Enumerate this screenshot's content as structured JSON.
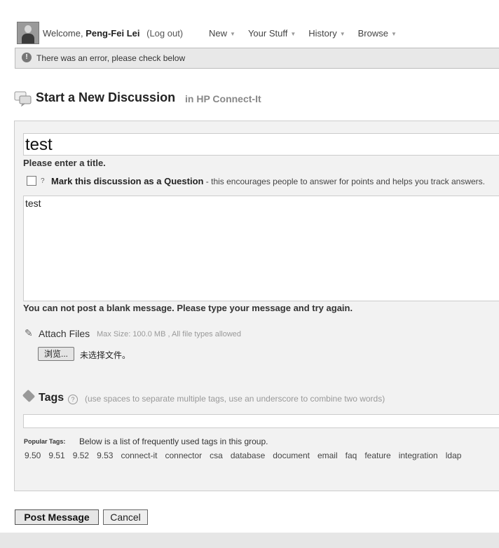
{
  "header": {
    "welcome_prefix": "Welcome,",
    "user_name": "Peng-Fei Lei",
    "logout": "(Log out)",
    "nav": [
      "New",
      "Your Stuff",
      "History",
      "Browse"
    ]
  },
  "error_bar": {
    "icon": "!",
    "message": "There was an error, please check below"
  },
  "page": {
    "title": "Start a New Discussion",
    "subtitle": "in HP Connect-It"
  },
  "form": {
    "title_value": "test",
    "title_error": "Please enter a title.",
    "question_label": "Mark this discussion as a Question",
    "question_desc": " - this encourages people to answer for points and helps you track answers.",
    "question_checked": false,
    "message_value": "test",
    "message_error": "You can not post a blank message. Please type your message and try again.",
    "attach_label": "Attach Files",
    "attach_note": "Max Size: 100.0 MB , All file types allowed",
    "browse_label": "浏览...",
    "no_file_text": "未选择文件。",
    "tags_label": "Tags",
    "tags_note": "(use spaces to separate multiple tags, use an underscore to combine two words)",
    "tags_value": "",
    "popular_label": "Popular Tags:",
    "popular_desc": "Below is a list of frequently used tags in this group.",
    "popular_tags": [
      "9.50",
      "9.51",
      "9.52",
      "9.53",
      "connect-it",
      "connector",
      "csa",
      "database",
      "document",
      "email",
      "faq",
      "feature",
      "integration",
      "ldap"
    ]
  },
  "actions": {
    "post_label": "Post Message",
    "cancel_label": "Cancel"
  }
}
